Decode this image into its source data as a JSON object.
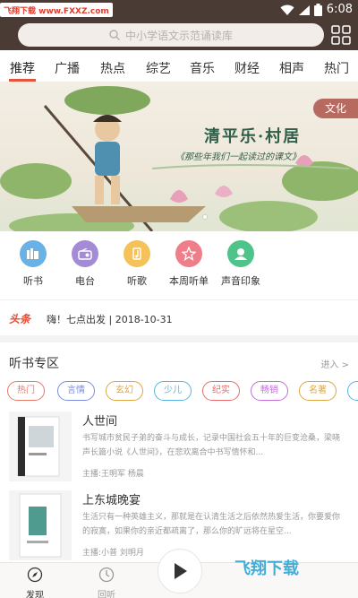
{
  "status_bar": {
    "watermark": "飞翔下载 www.FXXZ.com",
    "time": "6:08"
  },
  "search": {
    "placeholder": "中小学语文示范诵读库"
  },
  "tabs": [
    {
      "label": "推荐",
      "active": true
    },
    {
      "label": "广播"
    },
    {
      "label": "热点"
    },
    {
      "label": "综艺"
    },
    {
      "label": "音乐"
    },
    {
      "label": "财经"
    },
    {
      "label": "相声"
    },
    {
      "label": "热门"
    }
  ],
  "banner": {
    "tag": "文化",
    "title": "清平乐·村居",
    "subtitle": "《那些年我们一起读过的课文》"
  },
  "quick_nav": [
    {
      "label": "听书",
      "icon": "book-icon",
      "color": "#6ab1e6"
    },
    {
      "label": "电台",
      "icon": "radio-icon",
      "color": "#a48bd6"
    },
    {
      "label": "听歌",
      "icon": "music-icon",
      "color": "#f5c25a"
    },
    {
      "label": "本周听单",
      "icon": "star-icon",
      "color": "#ef7e8b"
    },
    {
      "label": "声音印象",
      "icon": "person-icon",
      "color": "#4fc48a"
    }
  ],
  "ticker": {
    "logo": "头条",
    "text": "嗨！七点出发 | 2018-10-31"
  },
  "section": {
    "title": "听书专区",
    "more": "进入 >"
  },
  "chips": [
    {
      "label": "热门",
      "color": "#e8776a"
    },
    {
      "label": "言情",
      "color": "#7b8de0"
    },
    {
      "label": "玄幻",
      "color": "#e0a640"
    },
    {
      "label": "少儿",
      "color": "#57b3e6"
    },
    {
      "label": "纪实",
      "color": "#e86c6c"
    },
    {
      "label": "畅销",
      "color": "#c26fd8"
    },
    {
      "label": "名著",
      "color": "#e0a640"
    }
  ],
  "books": [
    {
      "title": "人世间",
      "desc": "书写城市贫民子弟的奋斗与成长，记录中国社会五十年的巨变沧桑，梁晓声长篇小说《人世间》，在悲欢离合中书写情怀和...",
      "meta": "主播:王明军 杨晨"
    },
    {
      "title": "上东城晚宴",
      "desc": "生活只有一种英雄主义，那就是在认清生活之后依然热爱生活，你要爱你的寂寞，如果你的亲近都疏离了，那么你的旷远将在星空...",
      "meta": "主播:小普 刘明月"
    }
  ],
  "bottom_nav": [
    {
      "label": "发现",
      "icon": "compass-icon",
      "active": true
    },
    {
      "label": "回听",
      "icon": "clock-icon"
    }
  ],
  "site_watermark": "飞翔下载",
  "colors": {
    "header_bg": "#4a3b34",
    "accent": "#e5533c"
  }
}
